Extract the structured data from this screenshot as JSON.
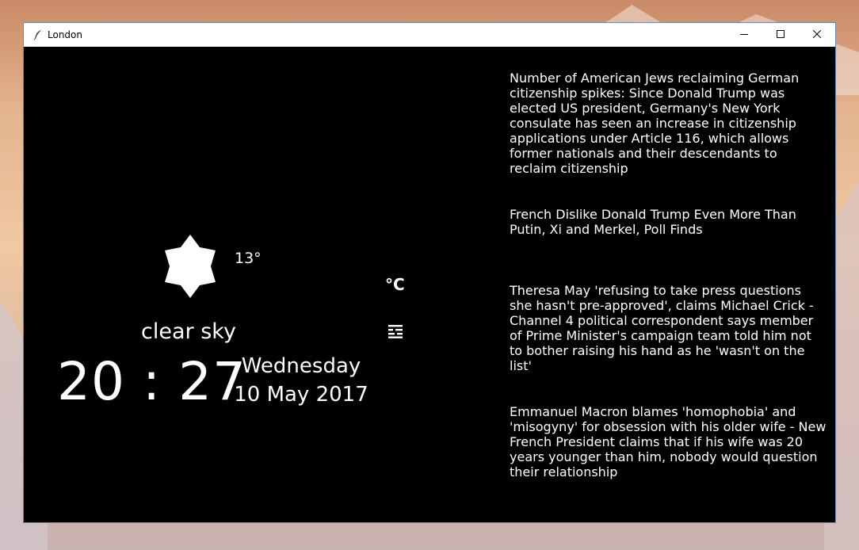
{
  "window": {
    "title": "London",
    "controls": {
      "minimize_icon": "minimize-icon",
      "maximize_icon": "maximize-icon",
      "close_icon": "close-icon"
    }
  },
  "weather": {
    "icon": "sun-icon",
    "temperature": "13°",
    "unit_label": "°C",
    "description": "clear sky"
  },
  "clock": {
    "time": "20 : 27",
    "day": "Wednesday",
    "date": "10 May 2017"
  },
  "news": [
    {
      "text": "Number of American Jews reclaiming German citizenship spikes: Since Donald Trump was elected US president, Germany's New York consulate has seen an increase in citizenship applications under Article 116, which allows former nationals and their descendants to reclaim citizenship"
    },
    {
      "text": "French Dislike Donald Trump Even More Than Putin, Xi and Merkel, Poll Finds"
    },
    {
      "text": "Theresa May 'refusing to take press questions she hasn't pre-approved', claims Michael Crick - Channel 4 political correspondent says member of Prime Minister's campaign team told him not to bother raising his hand as he 'wasn't on the list'"
    },
    {
      "text": "Emmanuel Macron blames 'homophobia' and 'misogyny' for obsession with his older wife - New French President claims that if his wife was 20 years younger than him, nobody would question their relationship"
    }
  ],
  "colors": {
    "background": "#000000",
    "text": "#ffffff",
    "titlebar": "#ffffff",
    "window_border": "#6a89b4"
  }
}
